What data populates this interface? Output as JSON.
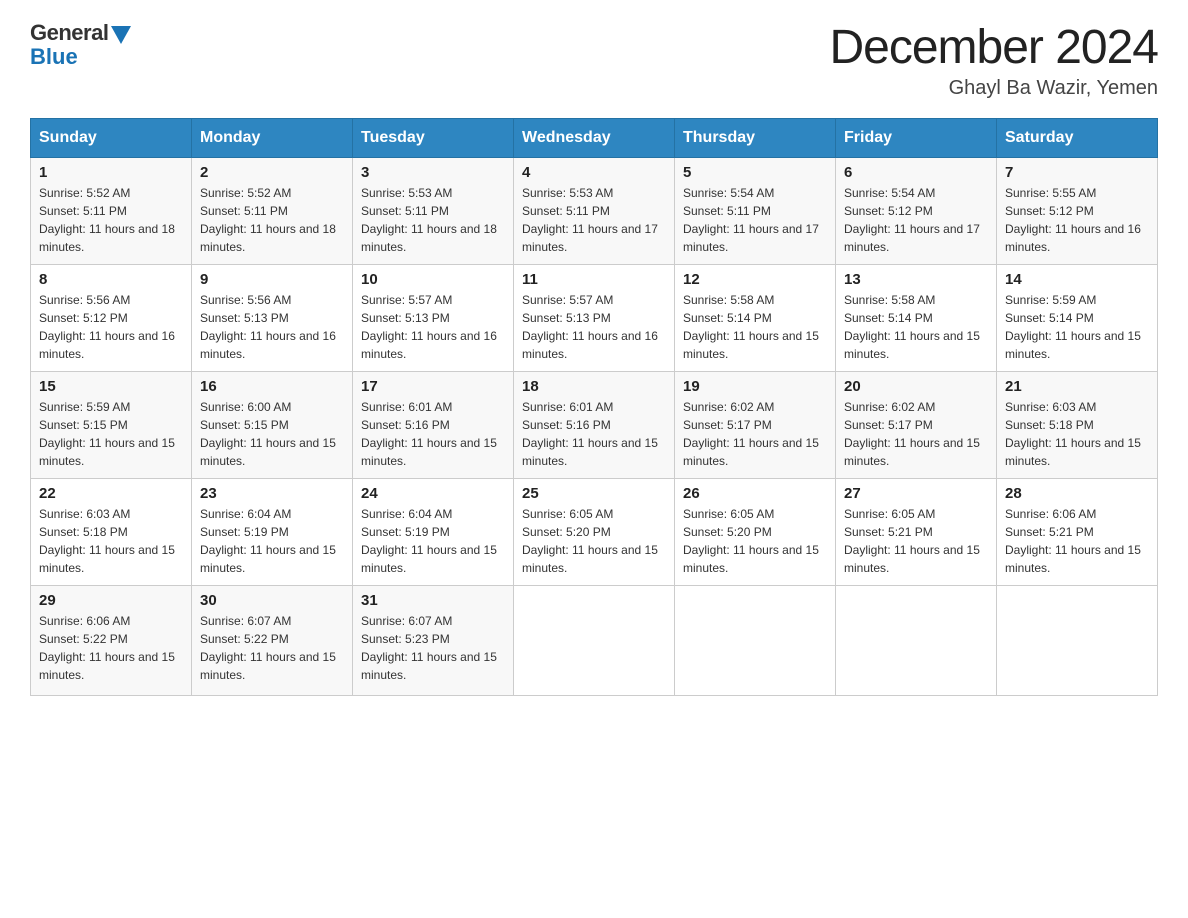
{
  "header": {
    "logo_general": "General",
    "logo_blue": "Blue",
    "month_title": "December 2024",
    "location": "Ghayl Ba Wazir, Yemen"
  },
  "days_of_week": [
    "Sunday",
    "Monday",
    "Tuesday",
    "Wednesday",
    "Thursday",
    "Friday",
    "Saturday"
  ],
  "weeks": [
    [
      {
        "day": "1",
        "sunrise": "Sunrise: 5:52 AM",
        "sunset": "Sunset: 5:11 PM",
        "daylight": "Daylight: 11 hours and 18 minutes."
      },
      {
        "day": "2",
        "sunrise": "Sunrise: 5:52 AM",
        "sunset": "Sunset: 5:11 PM",
        "daylight": "Daylight: 11 hours and 18 minutes."
      },
      {
        "day": "3",
        "sunrise": "Sunrise: 5:53 AM",
        "sunset": "Sunset: 5:11 PM",
        "daylight": "Daylight: 11 hours and 18 minutes."
      },
      {
        "day": "4",
        "sunrise": "Sunrise: 5:53 AM",
        "sunset": "Sunset: 5:11 PM",
        "daylight": "Daylight: 11 hours and 17 minutes."
      },
      {
        "day": "5",
        "sunrise": "Sunrise: 5:54 AM",
        "sunset": "Sunset: 5:11 PM",
        "daylight": "Daylight: 11 hours and 17 minutes."
      },
      {
        "day": "6",
        "sunrise": "Sunrise: 5:54 AM",
        "sunset": "Sunset: 5:12 PM",
        "daylight": "Daylight: 11 hours and 17 minutes."
      },
      {
        "day": "7",
        "sunrise": "Sunrise: 5:55 AM",
        "sunset": "Sunset: 5:12 PM",
        "daylight": "Daylight: 11 hours and 16 minutes."
      }
    ],
    [
      {
        "day": "8",
        "sunrise": "Sunrise: 5:56 AM",
        "sunset": "Sunset: 5:12 PM",
        "daylight": "Daylight: 11 hours and 16 minutes."
      },
      {
        "day": "9",
        "sunrise": "Sunrise: 5:56 AM",
        "sunset": "Sunset: 5:13 PM",
        "daylight": "Daylight: 11 hours and 16 minutes."
      },
      {
        "day": "10",
        "sunrise": "Sunrise: 5:57 AM",
        "sunset": "Sunset: 5:13 PM",
        "daylight": "Daylight: 11 hours and 16 minutes."
      },
      {
        "day": "11",
        "sunrise": "Sunrise: 5:57 AM",
        "sunset": "Sunset: 5:13 PM",
        "daylight": "Daylight: 11 hours and 16 minutes."
      },
      {
        "day": "12",
        "sunrise": "Sunrise: 5:58 AM",
        "sunset": "Sunset: 5:14 PM",
        "daylight": "Daylight: 11 hours and 15 minutes."
      },
      {
        "day": "13",
        "sunrise": "Sunrise: 5:58 AM",
        "sunset": "Sunset: 5:14 PM",
        "daylight": "Daylight: 11 hours and 15 minutes."
      },
      {
        "day": "14",
        "sunrise": "Sunrise: 5:59 AM",
        "sunset": "Sunset: 5:14 PM",
        "daylight": "Daylight: 11 hours and 15 minutes."
      }
    ],
    [
      {
        "day": "15",
        "sunrise": "Sunrise: 5:59 AM",
        "sunset": "Sunset: 5:15 PM",
        "daylight": "Daylight: 11 hours and 15 minutes."
      },
      {
        "day": "16",
        "sunrise": "Sunrise: 6:00 AM",
        "sunset": "Sunset: 5:15 PM",
        "daylight": "Daylight: 11 hours and 15 minutes."
      },
      {
        "day": "17",
        "sunrise": "Sunrise: 6:01 AM",
        "sunset": "Sunset: 5:16 PM",
        "daylight": "Daylight: 11 hours and 15 minutes."
      },
      {
        "day": "18",
        "sunrise": "Sunrise: 6:01 AM",
        "sunset": "Sunset: 5:16 PM",
        "daylight": "Daylight: 11 hours and 15 minutes."
      },
      {
        "day": "19",
        "sunrise": "Sunrise: 6:02 AM",
        "sunset": "Sunset: 5:17 PM",
        "daylight": "Daylight: 11 hours and 15 minutes."
      },
      {
        "day": "20",
        "sunrise": "Sunrise: 6:02 AM",
        "sunset": "Sunset: 5:17 PM",
        "daylight": "Daylight: 11 hours and 15 minutes."
      },
      {
        "day": "21",
        "sunrise": "Sunrise: 6:03 AM",
        "sunset": "Sunset: 5:18 PM",
        "daylight": "Daylight: 11 hours and 15 minutes."
      }
    ],
    [
      {
        "day": "22",
        "sunrise": "Sunrise: 6:03 AM",
        "sunset": "Sunset: 5:18 PM",
        "daylight": "Daylight: 11 hours and 15 minutes."
      },
      {
        "day": "23",
        "sunrise": "Sunrise: 6:04 AM",
        "sunset": "Sunset: 5:19 PM",
        "daylight": "Daylight: 11 hours and 15 minutes."
      },
      {
        "day": "24",
        "sunrise": "Sunrise: 6:04 AM",
        "sunset": "Sunset: 5:19 PM",
        "daylight": "Daylight: 11 hours and 15 minutes."
      },
      {
        "day": "25",
        "sunrise": "Sunrise: 6:05 AM",
        "sunset": "Sunset: 5:20 PM",
        "daylight": "Daylight: 11 hours and 15 minutes."
      },
      {
        "day": "26",
        "sunrise": "Sunrise: 6:05 AM",
        "sunset": "Sunset: 5:20 PM",
        "daylight": "Daylight: 11 hours and 15 minutes."
      },
      {
        "day": "27",
        "sunrise": "Sunrise: 6:05 AM",
        "sunset": "Sunset: 5:21 PM",
        "daylight": "Daylight: 11 hours and 15 minutes."
      },
      {
        "day": "28",
        "sunrise": "Sunrise: 6:06 AM",
        "sunset": "Sunset: 5:21 PM",
        "daylight": "Daylight: 11 hours and 15 minutes."
      }
    ],
    [
      {
        "day": "29",
        "sunrise": "Sunrise: 6:06 AM",
        "sunset": "Sunset: 5:22 PM",
        "daylight": "Daylight: 11 hours and 15 minutes."
      },
      {
        "day": "30",
        "sunrise": "Sunrise: 6:07 AM",
        "sunset": "Sunset: 5:22 PM",
        "daylight": "Daylight: 11 hours and 15 minutes."
      },
      {
        "day": "31",
        "sunrise": "Sunrise: 6:07 AM",
        "sunset": "Sunset: 5:23 PM",
        "daylight": "Daylight: 11 hours and 15 minutes."
      },
      null,
      null,
      null,
      null
    ]
  ]
}
